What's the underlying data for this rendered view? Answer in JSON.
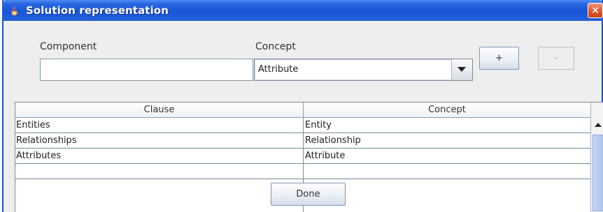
{
  "window": {
    "title": "Solution representation",
    "close_glyph": "×",
    "title_icon": "java-cup-icon"
  },
  "form": {
    "component_label": "Component",
    "component_value": "",
    "concept_label": "Concept",
    "concept_selected": "Attribute",
    "add_label": "+",
    "remove_label": "-"
  },
  "table": {
    "headers": [
      "Clause",
      "Concept"
    ],
    "rows": [
      [
        "Entities",
        "Entity"
      ],
      [
        "Relationships",
        "Relationship"
      ],
      [
        "Attributes",
        "Attribute"
      ],
      [
        "",
        ""
      ]
    ]
  },
  "footer": {
    "done_label": "Done"
  },
  "colors": {
    "titlebar": "#1a55d6",
    "window_bg": "#eeeeee",
    "close": "#e35a30"
  }
}
